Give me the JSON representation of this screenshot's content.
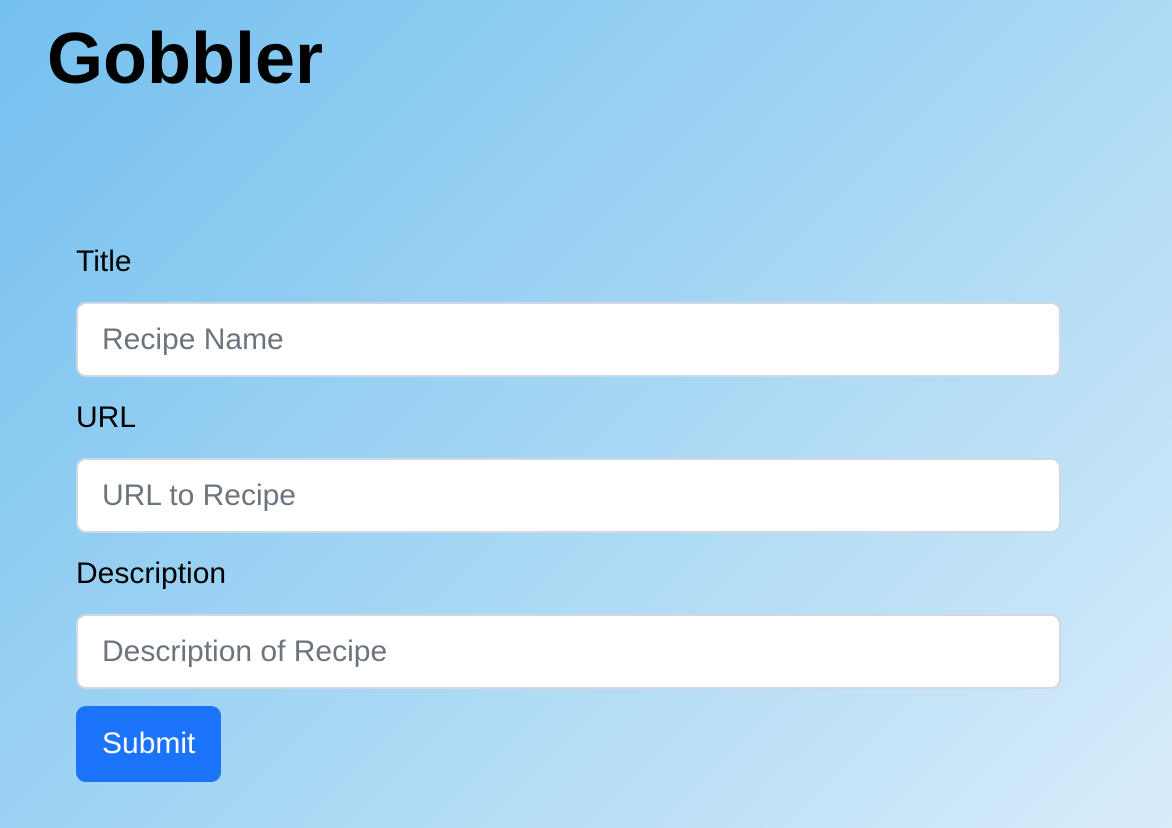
{
  "app": {
    "title": "Gobbler"
  },
  "form": {
    "title_field": {
      "label": "Title",
      "placeholder": "Recipe Name",
      "value": ""
    },
    "url_field": {
      "label": "URL",
      "placeholder": "URL to Recipe",
      "value": ""
    },
    "description_field": {
      "label": "Description",
      "placeholder": "Description of Recipe",
      "value": ""
    },
    "submit_label": "Submit"
  },
  "colors": {
    "primary_button": "#1a73f8",
    "input_border": "#cfd8e3",
    "placeholder_text": "#6c757d"
  }
}
